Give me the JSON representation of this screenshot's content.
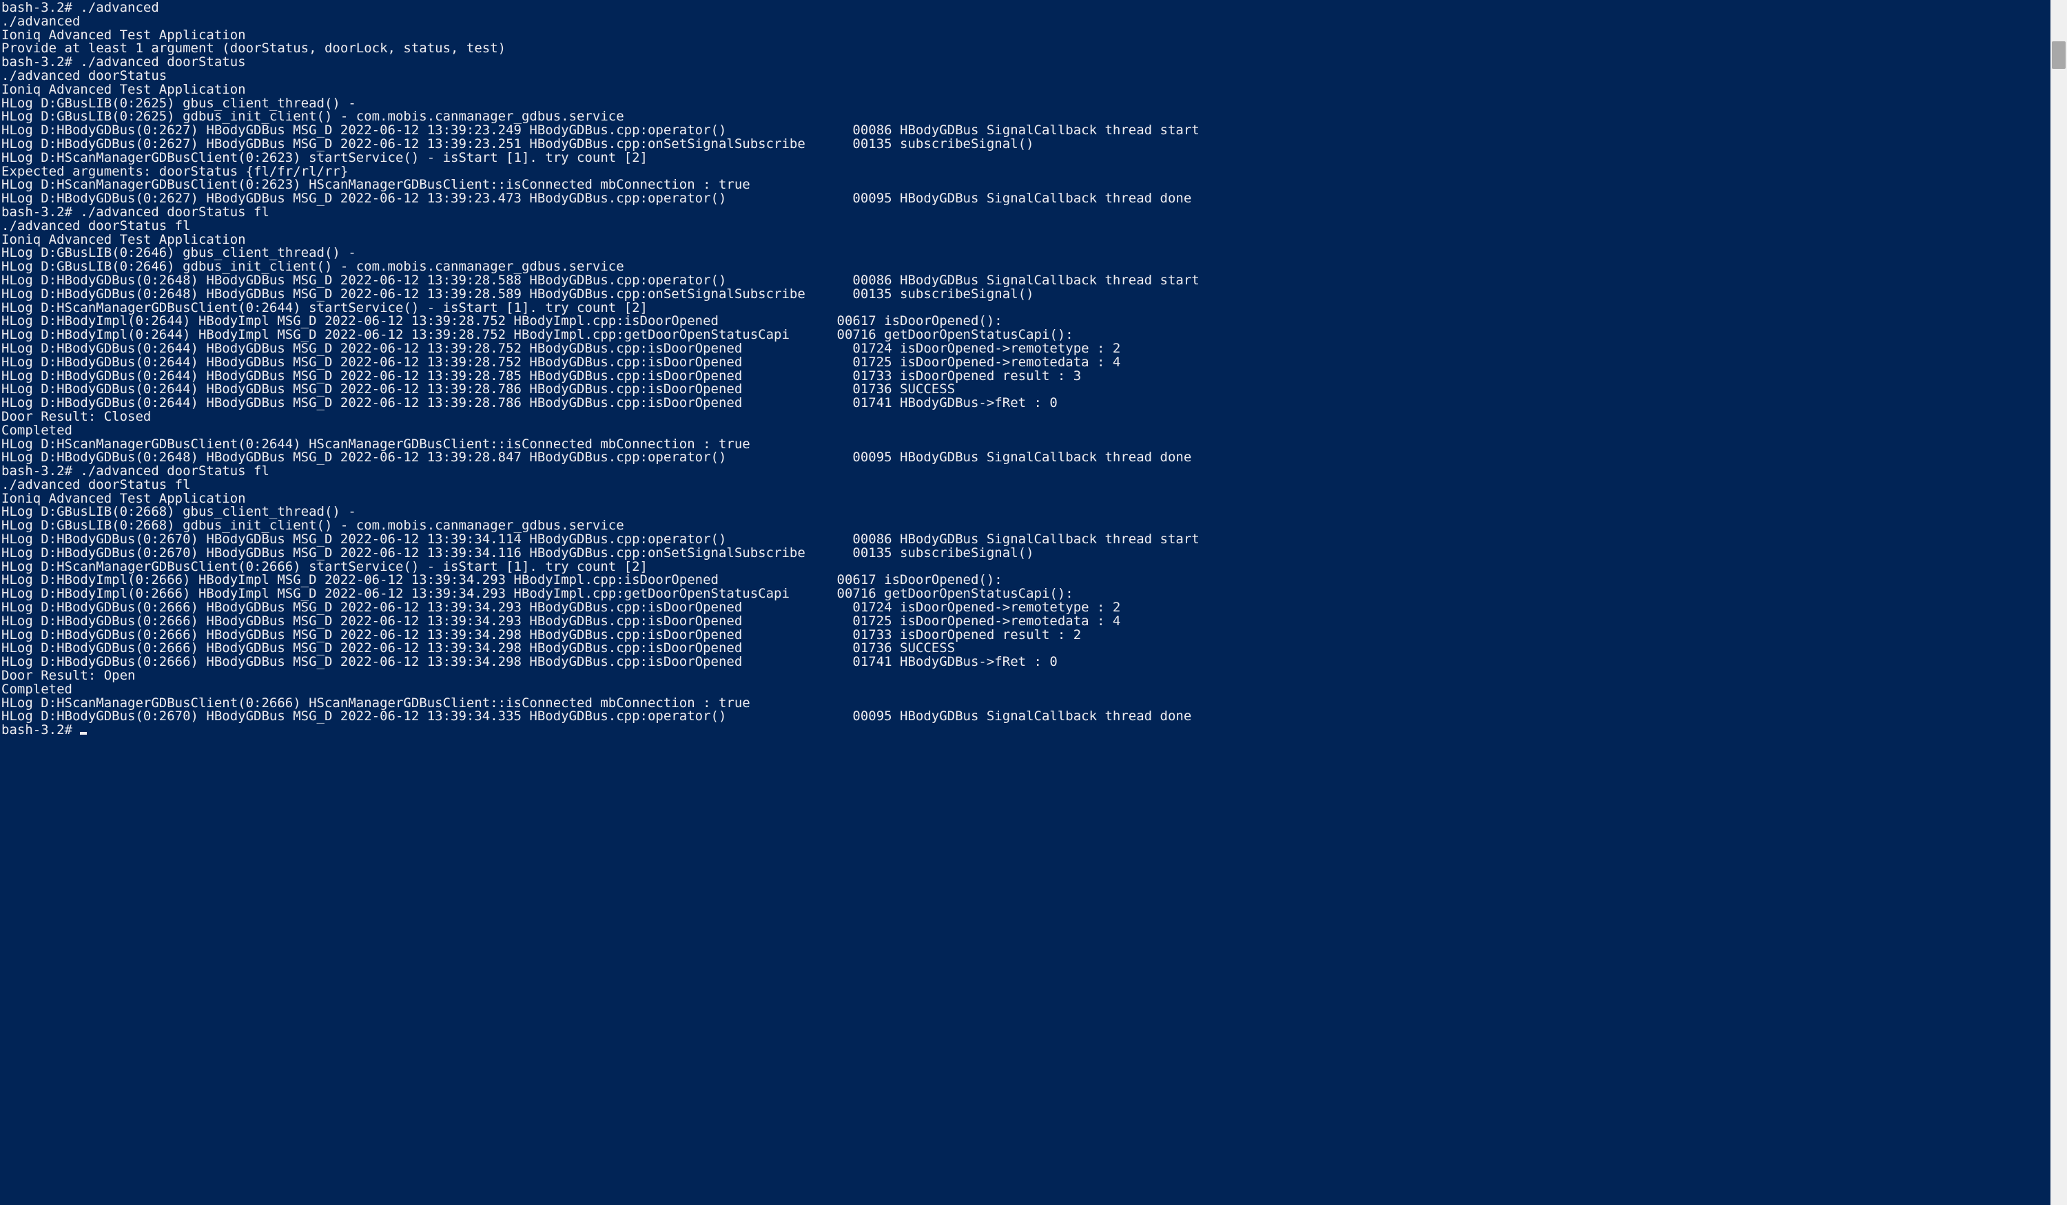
{
  "prompt": "bash-3.2# ",
  "terminal_lines": [
    "bash-3.2# ./advanced",
    "./advanced",
    "Ioniq Advanced Test Application",
    "Provide at least 1 argument (doorStatus, doorLock, status, test)",
    "bash-3.2# ./advanced doorStatus",
    "./advanced doorStatus",
    "Ioniq Advanced Test Application",
    "HLog D:GBusLIB(0:2625) gbus_client_thread() -",
    "HLog D:GBusLIB(0:2625) gdbus_init_client() - com.mobis.canmanager_gdbus.service",
    "HLog D:HBodyGDBus(0:2627) HBodyGDBus MSG_D 2022-06-12 13:39:23.249 HBodyGDBus.cpp:operator()                00086 HBodyGDBus SignalCallback thread start",
    "HLog D:HBodyGDBus(0:2627) HBodyGDBus MSG_D 2022-06-12 13:39:23.251 HBodyGDBus.cpp:onSetSignalSubscribe      00135 subscribeSignal()",
    "HLog D:HScanManagerGDBusClient(0:2623) startService() - isStart [1]. try count [2]",
    "Expected arguments: doorStatus {fl/fr/rl/rr}",
    "HLog D:HScanManagerGDBusClient(0:2623) HScanManagerGDBusClient::isConnected mbConnection : true",
    "HLog D:HBodyGDBus(0:2627) HBodyGDBus MSG_D 2022-06-12 13:39:23.473 HBodyGDBus.cpp:operator()                00095 HBodyGDBus SignalCallback thread done",
    "bash-3.2# ./advanced doorStatus fl",
    "./advanced doorStatus fl",
    "Ioniq Advanced Test Application",
    "HLog D:GBusLIB(0:2646) gbus_client_thread() -",
    "HLog D:GBusLIB(0:2646) gdbus_init_client() - com.mobis.canmanager_gdbus.service",
    "HLog D:HBodyGDBus(0:2648) HBodyGDBus MSG_D 2022-06-12 13:39:28.588 HBodyGDBus.cpp:operator()                00086 HBodyGDBus SignalCallback thread start",
    "HLog D:HBodyGDBus(0:2648) HBodyGDBus MSG_D 2022-06-12 13:39:28.589 HBodyGDBus.cpp:onSetSignalSubscribe      00135 subscribeSignal()",
    "HLog D:HScanManagerGDBusClient(0:2644) startService() - isStart [1]. try count [2]",
    "HLog D:HBodyImpl(0:2644) HBodyImpl MSG_D 2022-06-12 13:39:28.752 HBodyImpl.cpp:isDoorOpened               00617 isDoorOpened():",
    "HLog D:HBodyImpl(0:2644) HBodyImpl MSG_D 2022-06-12 13:39:28.752 HBodyImpl.cpp:getDoorOpenStatusCapi      00716 getDoorOpenStatusCapi():",
    "HLog D:HBodyGDBus(0:2644) HBodyGDBus MSG_D 2022-06-12 13:39:28.752 HBodyGDBus.cpp:isDoorOpened              01724 isDoorOpened->remotetype : 2",
    "HLog D:HBodyGDBus(0:2644) HBodyGDBus MSG_D 2022-06-12 13:39:28.752 HBodyGDBus.cpp:isDoorOpened              01725 isDoorOpened->remotedata : 4",
    "HLog D:HBodyGDBus(0:2644) HBodyGDBus MSG_D 2022-06-12 13:39:28.785 HBodyGDBus.cpp:isDoorOpened              01733 isDoorOpened result : 3",
    "HLog D:HBodyGDBus(0:2644) HBodyGDBus MSG_D 2022-06-12 13:39:28.786 HBodyGDBus.cpp:isDoorOpened              01736 SUCCESS",
    "HLog D:HBodyGDBus(0:2644) HBodyGDBus MSG_D 2022-06-12 13:39:28.786 HBodyGDBus.cpp:isDoorOpened              01741 HBodyGDBus->fRet : 0",
    "Door Result: Closed",
    "Completed",
    "HLog D:HScanManagerGDBusClient(0:2644) HScanManagerGDBusClient::isConnected mbConnection : true",
    "HLog D:HBodyGDBus(0:2648) HBodyGDBus MSG_D 2022-06-12 13:39:28.847 HBodyGDBus.cpp:operator()                00095 HBodyGDBus SignalCallback thread done",
    "bash-3.2# ./advanced doorStatus fl",
    "./advanced doorStatus fl",
    "Ioniq Advanced Test Application",
    "HLog D:GBusLIB(0:2668) gbus_client_thread() -",
    "HLog D:GBusLIB(0:2668) gdbus_init_client() - com.mobis.canmanager_gdbus.service",
    "HLog D:HBodyGDBus(0:2670) HBodyGDBus MSG_D 2022-06-12 13:39:34.114 HBodyGDBus.cpp:operator()                00086 HBodyGDBus SignalCallback thread start",
    "HLog D:HBodyGDBus(0:2670) HBodyGDBus MSG_D 2022-06-12 13:39:34.116 HBodyGDBus.cpp:onSetSignalSubscribe      00135 subscribeSignal()",
    "HLog D:HScanManagerGDBusClient(0:2666) startService() - isStart [1]. try count [2]",
    "HLog D:HBodyImpl(0:2666) HBodyImpl MSG_D 2022-06-12 13:39:34.293 HBodyImpl.cpp:isDoorOpened               00617 isDoorOpened():",
    "HLog D:HBodyImpl(0:2666) HBodyImpl MSG_D 2022-06-12 13:39:34.293 HBodyImpl.cpp:getDoorOpenStatusCapi      00716 getDoorOpenStatusCapi():",
    "HLog D:HBodyGDBus(0:2666) HBodyGDBus MSG_D 2022-06-12 13:39:34.293 HBodyGDBus.cpp:isDoorOpened              01724 isDoorOpened->remotetype : 2",
    "HLog D:HBodyGDBus(0:2666) HBodyGDBus MSG_D 2022-06-12 13:39:34.293 HBodyGDBus.cpp:isDoorOpened              01725 isDoorOpened->remotedata : 4",
    "HLog D:HBodyGDBus(0:2666) HBodyGDBus MSG_D 2022-06-12 13:39:34.298 HBodyGDBus.cpp:isDoorOpened              01733 isDoorOpened result : 2",
    "HLog D:HBodyGDBus(0:2666) HBodyGDBus MSG_D 2022-06-12 13:39:34.298 HBodyGDBus.cpp:isDoorOpened              01736 SUCCESS",
    "HLog D:HBodyGDBus(0:2666) HBodyGDBus MSG_D 2022-06-12 13:39:34.298 HBodyGDBus.cpp:isDoorOpened              01741 HBodyGDBus->fRet : 0",
    "Door Result: Open",
    "Completed",
    "HLog D:HScanManagerGDBusClient(0:2666) HScanManagerGDBusClient::isConnected mbConnection : true",
    "HLog D:HBodyGDBus(0:2670) HBodyGDBus MSG_D 2022-06-12 13:39:34.335 HBodyGDBus.cpp:operator()                00095 HBodyGDBus SignalCallback thread done"
  ],
  "scrollbar": {
    "visible": true
  }
}
